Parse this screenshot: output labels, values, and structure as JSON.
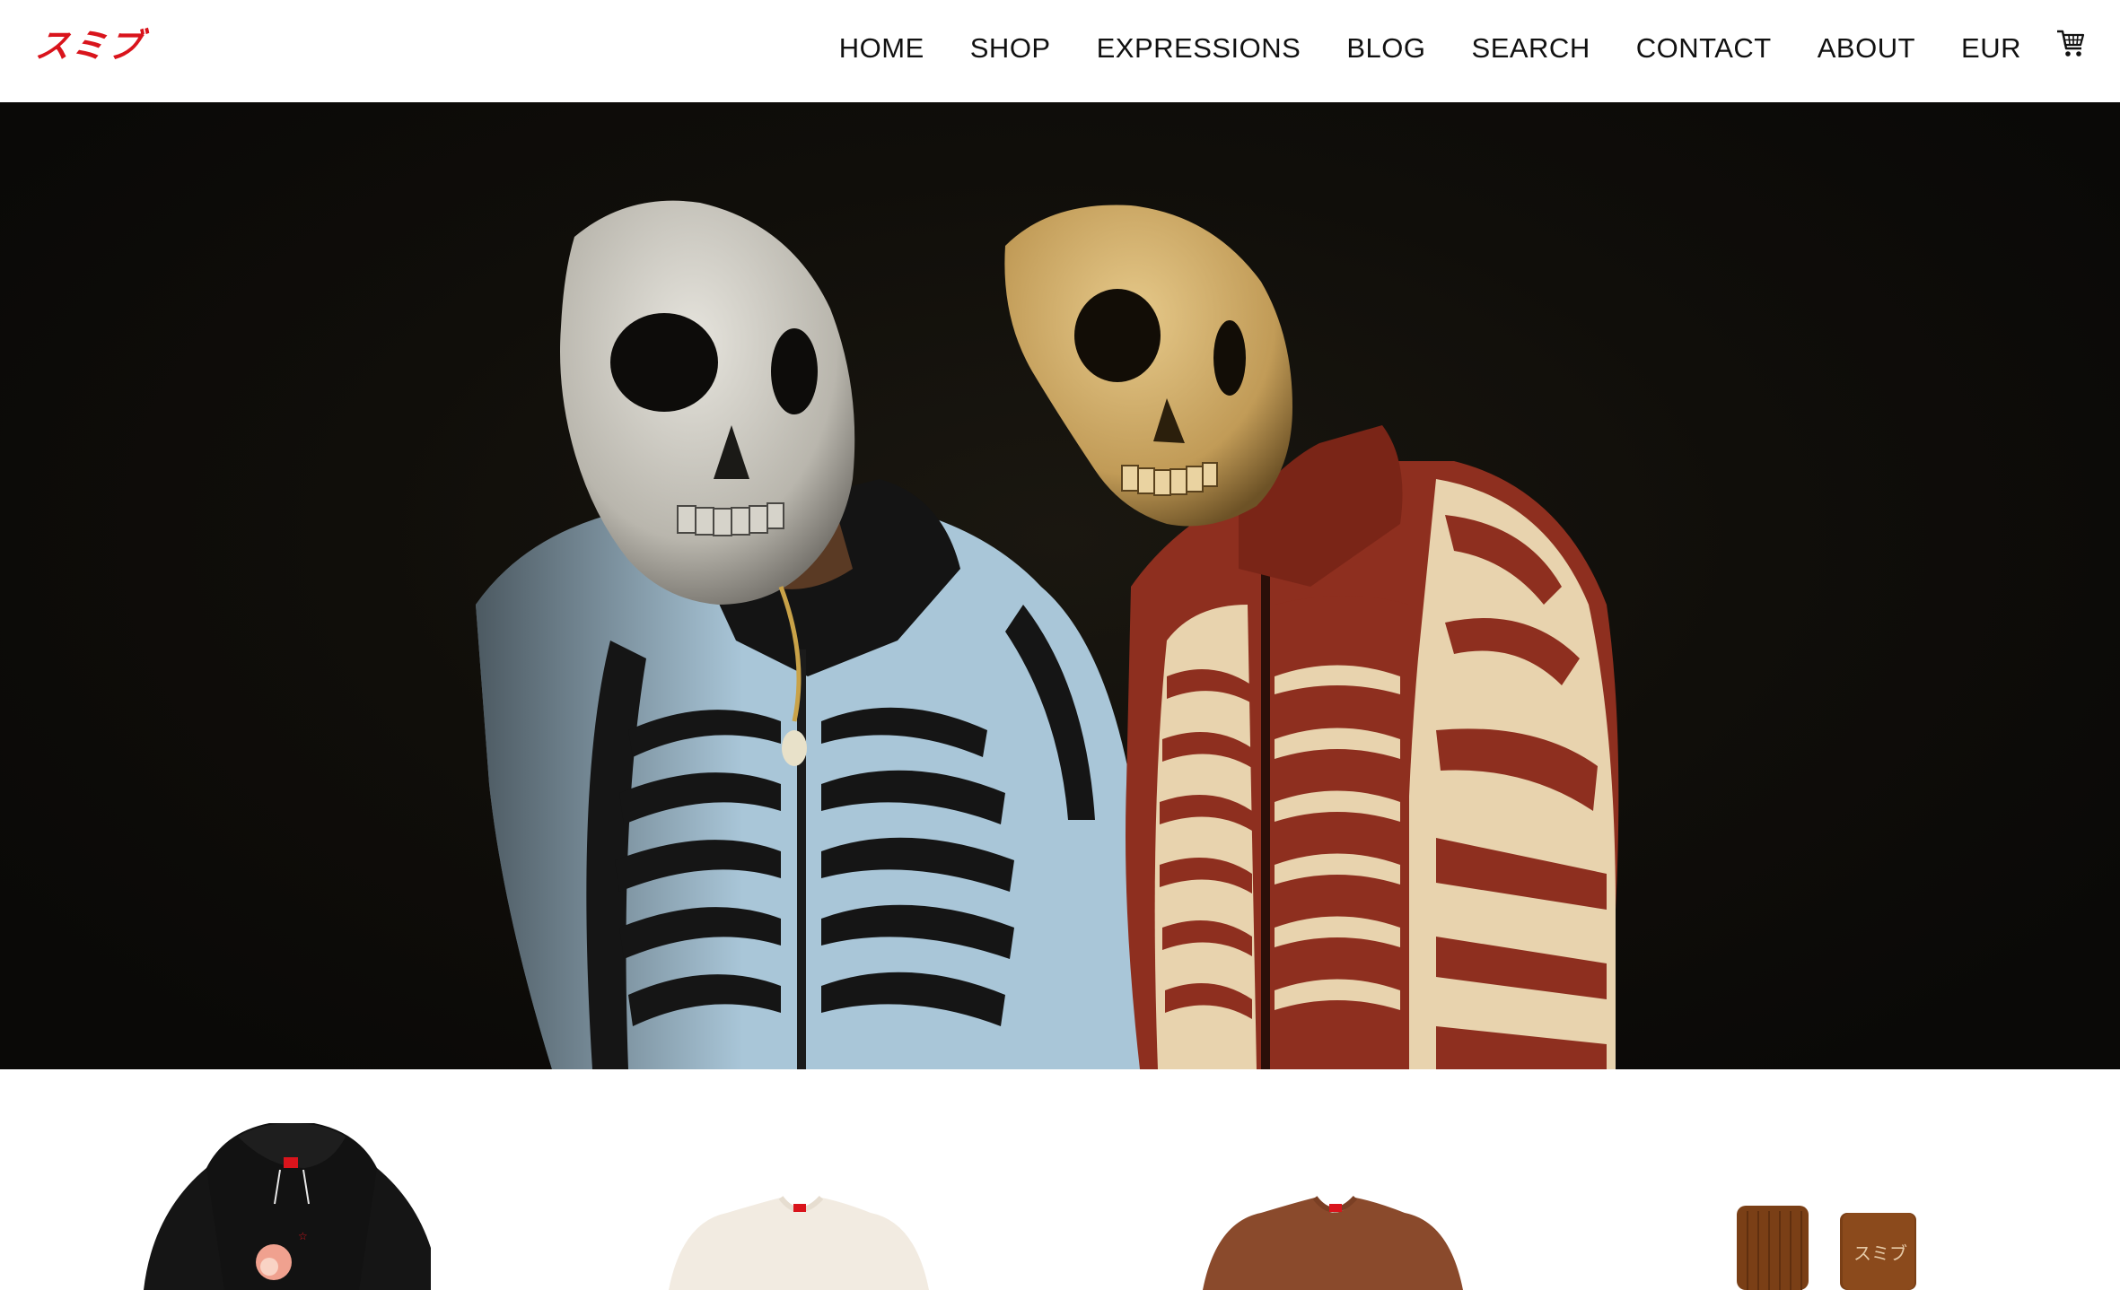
{
  "brand": {
    "logo_text": "スミブ",
    "logo_color": "#d9141c"
  },
  "nav": {
    "items": [
      "HOME",
      "SHOP",
      "EXPRESSIONS",
      "BLOG",
      "SEARCH",
      "CONTACT",
      "ABOUT",
      "EUR"
    ],
    "cart_icon": "shopping-cart-icon"
  },
  "hero": {
    "image": "two-models-in-skull-masks-and-skeleton-knit-cardigans",
    "left_cardigan_color": "#a9c6d8",
    "right_cardigan_color": "#8e2f1f"
  },
  "products": [
    {
      "image": "black-hoodie",
      "color": "#121212"
    },
    {
      "image": "cream-tshirt",
      "color": "#f2ebe1"
    },
    {
      "image": "brown-tshirt",
      "color": "#8a4a2c"
    },
    {
      "image": "brown-socks",
      "color": "#7a3f16",
      "print_text": "スミブ"
    }
  ]
}
